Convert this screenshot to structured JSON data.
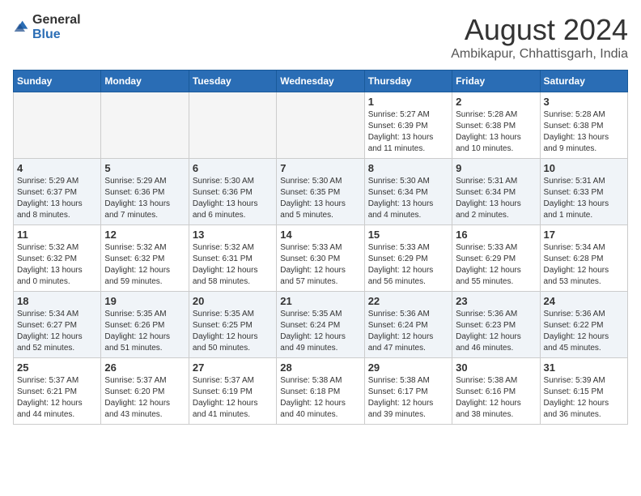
{
  "header": {
    "logo_general": "General",
    "logo_blue": "Blue",
    "month_year": "August 2024",
    "location": "Ambikapur, Chhattisgarh, India"
  },
  "weekdays": [
    "Sunday",
    "Monday",
    "Tuesday",
    "Wednesday",
    "Thursday",
    "Friday",
    "Saturday"
  ],
  "weeks": [
    [
      {
        "day": "",
        "info": ""
      },
      {
        "day": "",
        "info": ""
      },
      {
        "day": "",
        "info": ""
      },
      {
        "day": "",
        "info": ""
      },
      {
        "day": "1",
        "info": "Sunrise: 5:27 AM\nSunset: 6:39 PM\nDaylight: 13 hours\nand 11 minutes."
      },
      {
        "day": "2",
        "info": "Sunrise: 5:28 AM\nSunset: 6:38 PM\nDaylight: 13 hours\nand 10 minutes."
      },
      {
        "day": "3",
        "info": "Sunrise: 5:28 AM\nSunset: 6:38 PM\nDaylight: 13 hours\nand 9 minutes."
      }
    ],
    [
      {
        "day": "4",
        "info": "Sunrise: 5:29 AM\nSunset: 6:37 PM\nDaylight: 13 hours\nand 8 minutes."
      },
      {
        "day": "5",
        "info": "Sunrise: 5:29 AM\nSunset: 6:36 PM\nDaylight: 13 hours\nand 7 minutes."
      },
      {
        "day": "6",
        "info": "Sunrise: 5:30 AM\nSunset: 6:36 PM\nDaylight: 13 hours\nand 6 minutes."
      },
      {
        "day": "7",
        "info": "Sunrise: 5:30 AM\nSunset: 6:35 PM\nDaylight: 13 hours\nand 5 minutes."
      },
      {
        "day": "8",
        "info": "Sunrise: 5:30 AM\nSunset: 6:34 PM\nDaylight: 13 hours\nand 4 minutes."
      },
      {
        "day": "9",
        "info": "Sunrise: 5:31 AM\nSunset: 6:34 PM\nDaylight: 13 hours\nand 2 minutes."
      },
      {
        "day": "10",
        "info": "Sunrise: 5:31 AM\nSunset: 6:33 PM\nDaylight: 13 hours\nand 1 minute."
      }
    ],
    [
      {
        "day": "11",
        "info": "Sunrise: 5:32 AM\nSunset: 6:32 PM\nDaylight: 13 hours\nand 0 minutes."
      },
      {
        "day": "12",
        "info": "Sunrise: 5:32 AM\nSunset: 6:32 PM\nDaylight: 12 hours\nand 59 minutes."
      },
      {
        "day": "13",
        "info": "Sunrise: 5:32 AM\nSunset: 6:31 PM\nDaylight: 12 hours\nand 58 minutes."
      },
      {
        "day": "14",
        "info": "Sunrise: 5:33 AM\nSunset: 6:30 PM\nDaylight: 12 hours\nand 57 minutes."
      },
      {
        "day": "15",
        "info": "Sunrise: 5:33 AM\nSunset: 6:29 PM\nDaylight: 12 hours\nand 56 minutes."
      },
      {
        "day": "16",
        "info": "Sunrise: 5:33 AM\nSunset: 6:29 PM\nDaylight: 12 hours\nand 55 minutes."
      },
      {
        "day": "17",
        "info": "Sunrise: 5:34 AM\nSunset: 6:28 PM\nDaylight: 12 hours\nand 53 minutes."
      }
    ],
    [
      {
        "day": "18",
        "info": "Sunrise: 5:34 AM\nSunset: 6:27 PM\nDaylight: 12 hours\nand 52 minutes."
      },
      {
        "day": "19",
        "info": "Sunrise: 5:35 AM\nSunset: 6:26 PM\nDaylight: 12 hours\nand 51 minutes."
      },
      {
        "day": "20",
        "info": "Sunrise: 5:35 AM\nSunset: 6:25 PM\nDaylight: 12 hours\nand 50 minutes."
      },
      {
        "day": "21",
        "info": "Sunrise: 5:35 AM\nSunset: 6:24 PM\nDaylight: 12 hours\nand 49 minutes."
      },
      {
        "day": "22",
        "info": "Sunrise: 5:36 AM\nSunset: 6:24 PM\nDaylight: 12 hours\nand 47 minutes."
      },
      {
        "day": "23",
        "info": "Sunrise: 5:36 AM\nSunset: 6:23 PM\nDaylight: 12 hours\nand 46 minutes."
      },
      {
        "day": "24",
        "info": "Sunrise: 5:36 AM\nSunset: 6:22 PM\nDaylight: 12 hours\nand 45 minutes."
      }
    ],
    [
      {
        "day": "25",
        "info": "Sunrise: 5:37 AM\nSunset: 6:21 PM\nDaylight: 12 hours\nand 44 minutes."
      },
      {
        "day": "26",
        "info": "Sunrise: 5:37 AM\nSunset: 6:20 PM\nDaylight: 12 hours\nand 43 minutes."
      },
      {
        "day": "27",
        "info": "Sunrise: 5:37 AM\nSunset: 6:19 PM\nDaylight: 12 hours\nand 41 minutes."
      },
      {
        "day": "28",
        "info": "Sunrise: 5:38 AM\nSunset: 6:18 PM\nDaylight: 12 hours\nand 40 minutes."
      },
      {
        "day": "29",
        "info": "Sunrise: 5:38 AM\nSunset: 6:17 PM\nDaylight: 12 hours\nand 39 minutes."
      },
      {
        "day": "30",
        "info": "Sunrise: 5:38 AM\nSunset: 6:16 PM\nDaylight: 12 hours\nand 38 minutes."
      },
      {
        "day": "31",
        "info": "Sunrise: 5:39 AM\nSunset: 6:15 PM\nDaylight: 12 hours\nand 36 minutes."
      }
    ]
  ]
}
